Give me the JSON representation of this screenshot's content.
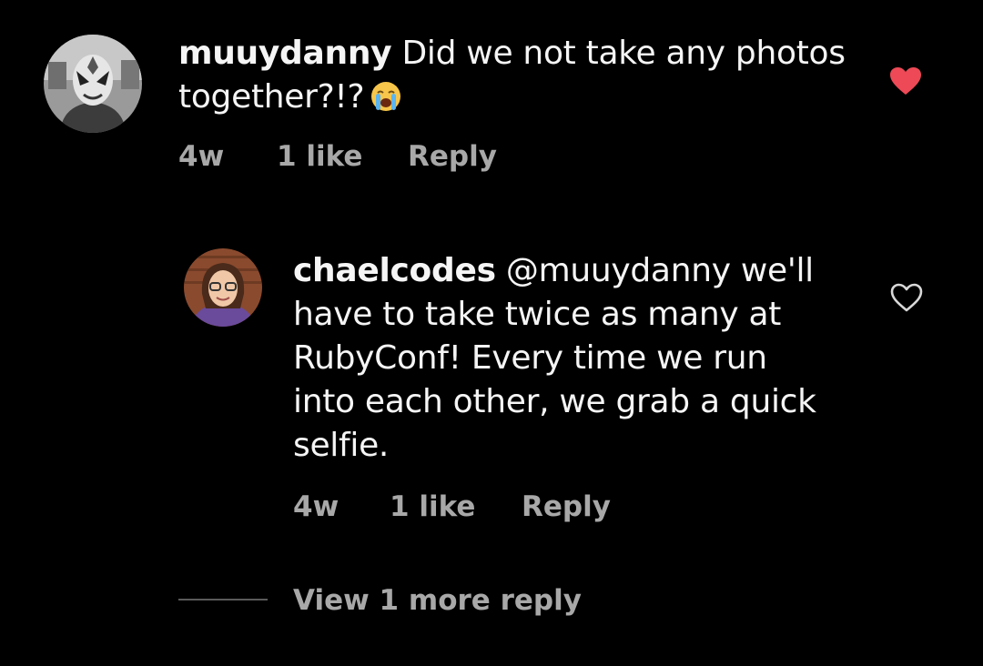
{
  "comments": [
    {
      "username": "muuydanny",
      "text": "Did we not take any photos together?!?",
      "emoji": "loudly-crying-face",
      "time": "4w",
      "likes": "1 like",
      "reply_label": "Reply",
      "liked": true
    }
  ],
  "reply": {
    "username": "chaelcodes",
    "mention": "@muuydanny",
    "text_line1_rest": "we'll",
    "text_rest": [
      "have to take twice as many at",
      "RubyConf! Every time we run",
      "into each other, we grab a quick",
      "selfie."
    ],
    "time": "4w",
    "likes": "1 like",
    "reply_label": "Reply",
    "liked": false
  },
  "view_more": "View 1 more reply",
  "colors": {
    "background": "#000000",
    "text": "#f5f5f5",
    "meta": "#a8a8a8",
    "liked_heart": "#ed4956"
  }
}
